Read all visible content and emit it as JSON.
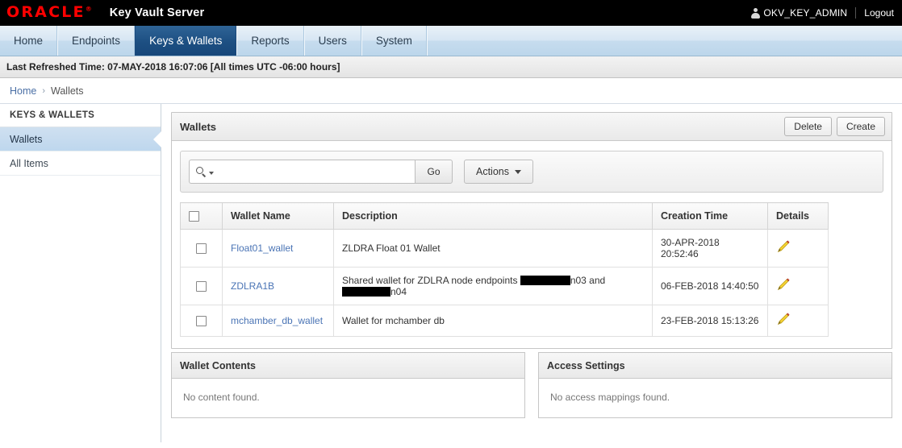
{
  "header": {
    "logo_text": "ORACLE",
    "logo_mark": "®",
    "app_title": "Key Vault Server",
    "user_name": "OKV_KEY_ADMIN",
    "logout_label": "Logout"
  },
  "nav": {
    "tabs": [
      {
        "label": "Home",
        "active": false
      },
      {
        "label": "Endpoints",
        "active": false
      },
      {
        "label": "Keys & Wallets",
        "active": true
      },
      {
        "label": "Reports",
        "active": false
      },
      {
        "label": "Users",
        "active": false
      },
      {
        "label": "System",
        "active": false
      }
    ]
  },
  "refresh_bar": {
    "text": "Last Refreshed Time: 07-MAY-2018 16:07:06 [All times UTC -06:00 hours]"
  },
  "breadcrumb": {
    "home": "Home",
    "separator": "›",
    "current": "Wallets"
  },
  "sidebar": {
    "header": "KEYS & WALLETS",
    "items": [
      {
        "label": "Wallets",
        "selected": true
      },
      {
        "label": "All Items",
        "selected": false
      }
    ]
  },
  "region": {
    "title": "Wallets",
    "delete_label": "Delete",
    "create_label": "Create"
  },
  "search": {
    "value": "",
    "placeholder": "",
    "go_label": "Go",
    "actions_label": "Actions"
  },
  "table": {
    "columns": [
      "",
      "Wallet Name",
      "Description",
      "Creation Time",
      "Details"
    ],
    "rows": [
      {
        "wallet_name": "Float01_wallet",
        "description": "ZLDRA Float 01 Wallet",
        "description_parts": [
          {
            "type": "text",
            "value": "ZLDRA Float 01 Wallet"
          }
        ],
        "creation_time": "30-APR-2018 20:52:46",
        "details_icon": "pencil-icon"
      },
      {
        "wallet_name": "ZDLRA1B",
        "description": "Shared wallet for ZDLRA node endpoints █████n03 and █████n04",
        "description_parts": [
          {
            "type": "text",
            "value": "Shared wallet for ZDLRA node endpoints "
          },
          {
            "type": "redaction",
            "width": 62
          },
          {
            "type": "text",
            "value": "n03 and "
          },
          {
            "type": "break"
          },
          {
            "type": "redaction",
            "width": 60
          },
          {
            "type": "text",
            "value": "n04"
          }
        ],
        "creation_time": "06-FEB-2018 14:40:50",
        "details_icon": "pencil-icon"
      },
      {
        "wallet_name": "mchamber_db_wallet",
        "description": "Wallet for mchamber db",
        "description_parts": [
          {
            "type": "text",
            "value": "Wallet for mchamber db"
          }
        ],
        "creation_time": "23-FEB-2018 15:13:26",
        "details_icon": "pencil-icon"
      }
    ]
  },
  "bottom_panels": [
    {
      "title": "Wallet Contents",
      "empty_message": "No content found."
    },
    {
      "title": "Access Settings",
      "empty_message": "No access mappings found."
    }
  ],
  "colors": {
    "brand_red": "#ff0000",
    "active_tab_blue": "#1d4f82",
    "link_blue": "#4a74b5",
    "topbar_black": "#000000",
    "sidebar_selected": "#bed7ee"
  }
}
